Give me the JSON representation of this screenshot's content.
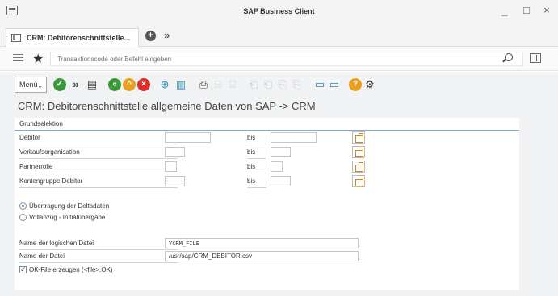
{
  "window": {
    "title": "SAP Business Client",
    "minimize_glyph": "_",
    "maximize_glyph": "□",
    "close_glyph": "×"
  },
  "tabs": {
    "active_label": "CRM: Debitorenschnittstelle...",
    "add_glyph": "+",
    "more_glyph": "»"
  },
  "command": {
    "placeholder": "Transaktionscode oder Befehl eingeben"
  },
  "toolbar": {
    "menu_label": "Menü",
    "menu_caret": "⌄",
    "icons": [
      "check-icon",
      "double-arrow-icon",
      "save-icon",
      "back-icon",
      "exit-icon",
      "cancel-icon",
      "execute-icon",
      "variant-icon",
      "print-icon",
      "find-icon",
      "find-next-icon",
      "first-page-icon",
      "previous-page-icon",
      "next-page-icon",
      "last-page-icon",
      "new-session-icon",
      "shortcut-icon",
      "help-icon",
      "settings-icon"
    ]
  },
  "page": {
    "title": "CRM: Debitorenschnittstelle allgemeine Daten von SAP -> CRM"
  },
  "group": {
    "title": "Grundselektion",
    "rows": [
      {
        "label": "Debitor",
        "from": "",
        "bis": "bis",
        "to": ""
      },
      {
        "label": "Verkaufsorganisation",
        "from": "",
        "bis": "bis",
        "to": ""
      },
      {
        "label": "Partnerrolle",
        "from": "",
        "bis": "bis",
        "to": ""
      },
      {
        "label": "Kontengruppe Debitor",
        "from": "",
        "bis": "bis",
        "to": ""
      }
    ],
    "radio_delta": "Übertragung der Deltadaten",
    "radio_full": "Vollabzug - Initialübergabe",
    "radio_selected": "delta",
    "logical_file_label": "Name der logischen Datei",
    "logical_file_value": "YCRM_FILE",
    "file_label": "Name der Datei",
    "file_value": "/usr/sap/CRM_DEBITOR.csv",
    "okfile_label": "OK-File erzeugen (<file>.OK)",
    "okfile_checked": true
  },
  "colors": {
    "accent_line": "#8aa8c8",
    "green": "#3a9a3a",
    "orange": "#e9a020",
    "red": "#d9302c"
  }
}
